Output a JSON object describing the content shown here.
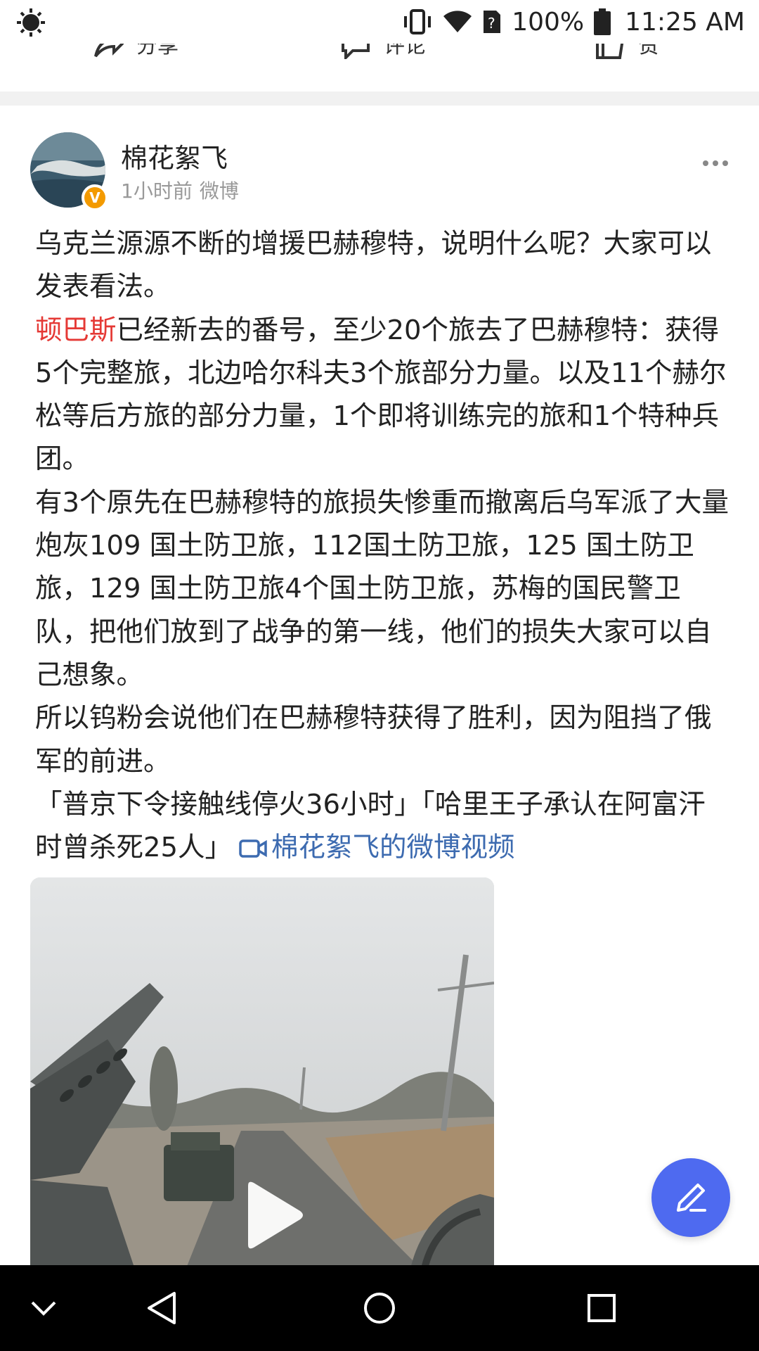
{
  "status_bar": {
    "battery": "100%",
    "time": "11:25 AM",
    "icons": [
      "brightness-icon",
      "vibrate-icon",
      "wifi-icon",
      "sim-unknown-icon",
      "battery-icon"
    ]
  },
  "prev_post_actions": {
    "share_label": "分享",
    "comment_label": "评论",
    "like_label": "赞"
  },
  "post": {
    "author": "棉花絮飞",
    "time_ago": "1小时前",
    "source": "微博",
    "verified_badge": "V",
    "paragraphs": {
      "p1": "乌克兰源源不断的增援巴赫穆特，说明什么呢？大家可以发表看法。",
      "p2_highlight": "顿巴斯",
      "p2_rest": "已经新去的番号，至少20个旅去了巴赫穆特：获得5个完整旅，北边哈尔科夫3个旅部分力量。以及11个赫尔松等后方旅的部分力量，1个即将训练完的旅和1个特种兵团。",
      "p3": "有3个原先在巴赫穆特的旅损失惨重而撤离后乌军派了大量炮灰109 国土防卫旅，112国土防卫旅，125 国土防卫旅，129 国土防卫旅4个国土防卫旅，苏梅的国民警卫队，把他们放到了战争的第一线，他们的损失大家可以自己想象。",
      "p4": "所以钨粉会说他们在巴赫穆特获得了胜利，因为阻挡了俄军的前进。",
      "p5_topics": "「普京下令接触线停火36小时」「哈里王子承认在阿富汗时曾杀死25人」",
      "video_link": "棉花絮飞的微博视频"
    }
  },
  "colors": {
    "highlight_red": "#e53935",
    "link_blue": "#3d6bb0",
    "fab_blue": "#4e6af0",
    "badge_orange": "#f39a00"
  }
}
